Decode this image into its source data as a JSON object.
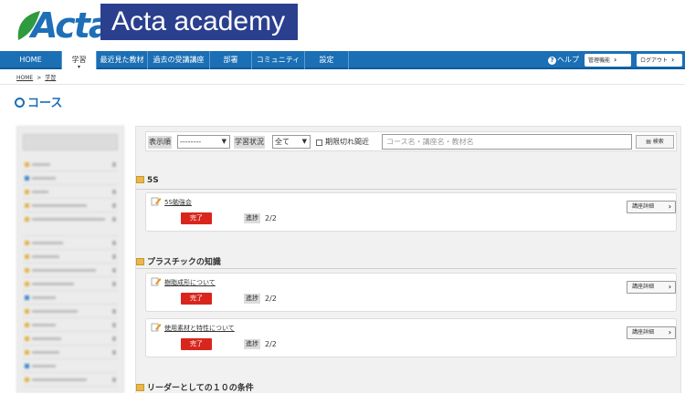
{
  "header": {
    "logo_text": "Acta",
    "brand": "Acta academy"
  },
  "nav": {
    "items": [
      "HOME",
      "学習",
      "最近見た教材",
      "過去の受講講座",
      "部署",
      "コミュニティ",
      "設定"
    ],
    "active": "学習",
    "help": "ヘルプ",
    "admin_button": "管理機能",
    "logout_button": "ログアウト"
  },
  "breadcrumb": {
    "home": "HOME",
    "separator": ">",
    "current": "学習"
  },
  "page_title": "コース",
  "filters": {
    "sort_label": "表示順",
    "sort_value": "--------",
    "status_label": "学習状況",
    "status_value": "全て",
    "expiring_label": "期限切れ間近",
    "search_placeholder": "コース名・講座名・教材名",
    "search_button": "検索"
  },
  "sections": [
    {
      "title": "5S",
      "items": [
        {
          "title": "5S勉強会",
          "status": "完了",
          "progress_label": "進捗",
          "progress": "2/2",
          "detail": "講座詳細"
        }
      ]
    },
    {
      "title": "プラスチックの知識",
      "items": [
        {
          "title": "樹脂成形について",
          "status": "完了",
          "progress_label": "進捗",
          "progress": "2/2",
          "detail": "講座詳細"
        },
        {
          "title": "使用素材と特性について",
          "status": "完了",
          "progress_label": "進捗",
          "progress": "2/2",
          "detail": "講座詳細"
        }
      ]
    },
    {
      "title": "リーダーとしての１０の条件",
      "items": []
    }
  ],
  "colors": {
    "nav_blue": "#1b6fb5",
    "brand_navy": "#2b3f8f",
    "done_red": "#d9261c",
    "title_blue": "#1a6fb5"
  }
}
